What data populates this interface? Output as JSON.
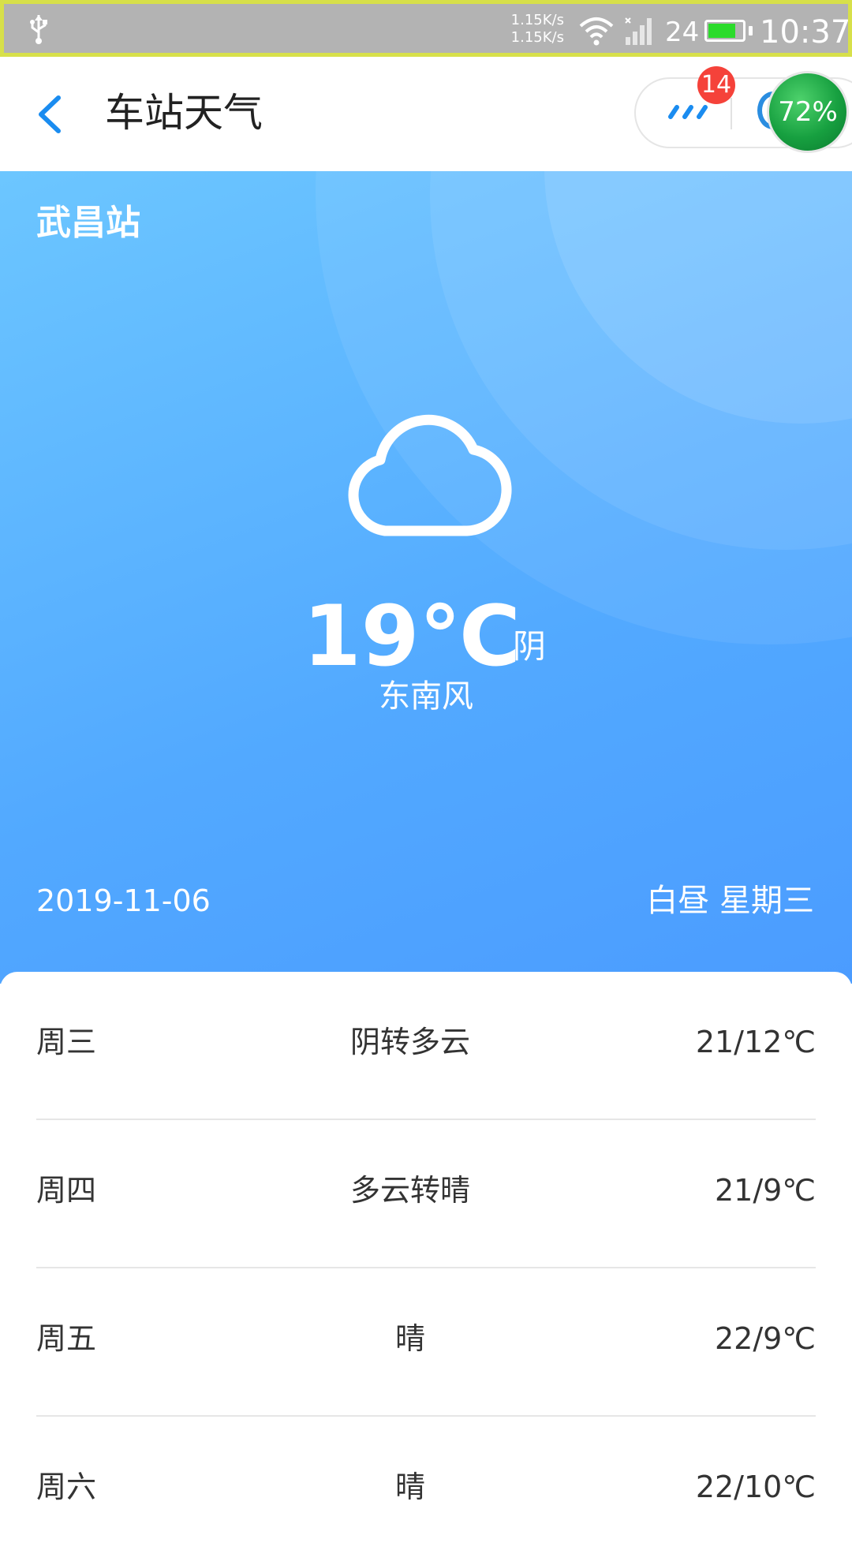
{
  "status_bar": {
    "speed_up": "1.15K/s",
    "speed_down": "1.15K/s",
    "signal_number": "24",
    "time": "10:37",
    "battery_level": 0.8,
    "battery_color": "#2bdb2b",
    "icons": [
      "usb-icon",
      "wifi-icon",
      "signal-icon",
      "battery-icon"
    ]
  },
  "header": {
    "title": "车站天气",
    "badge_count": "14",
    "widget_percent": "72%",
    "back_icon": "chevron-left-icon",
    "more_icon": "more-dots-icon",
    "accent": "#1a8cf0"
  },
  "weather": {
    "station": "武昌站",
    "temperature": "19℃",
    "condition": "阴",
    "wind": "东南风",
    "date": "2019-11-06",
    "period_weekday": "白昼 星期三",
    "icon": "cloud-icon",
    "gradient_top": "#6cc6ff",
    "gradient_bottom": "#4b9cff"
  },
  "forecast": [
    {
      "day": "周三",
      "desc": "阴转多云",
      "range": "21/12℃"
    },
    {
      "day": "周四",
      "desc": "多云转晴",
      "range": "21/9℃"
    },
    {
      "day": "周五",
      "desc": "晴",
      "range": "22/9℃"
    },
    {
      "day": "周六",
      "desc": "晴",
      "range": "22/10℃"
    }
  ]
}
